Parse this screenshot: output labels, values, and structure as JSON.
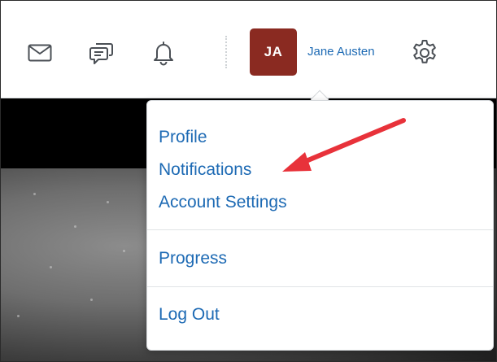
{
  "header": {
    "icons": {
      "messages": "envelope-icon",
      "discussions": "chat-bubbles-icon",
      "notifications": "bell-icon",
      "settings": "gear-icon"
    },
    "avatar_initials": "JA",
    "user_name": "Jane Austen"
  },
  "user_menu": {
    "groups": [
      [
        "Profile",
        "Notifications",
        "Account Settings"
      ],
      [
        "Progress"
      ],
      [
        "Log Out"
      ]
    ],
    "items": {
      "profile": "Profile",
      "notifications": "Notifications",
      "account_settings": "Account Settings",
      "progress": "Progress",
      "log_out": "Log Out"
    }
  },
  "colors": {
    "link": "#1d6ab4",
    "avatar_bg": "#8a2a21",
    "annotation_arrow": "#e8323a",
    "icon_stroke": "#4a4f55"
  }
}
